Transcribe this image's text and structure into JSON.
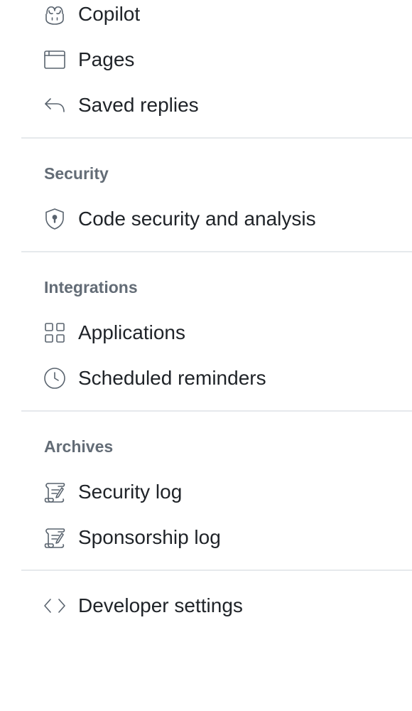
{
  "nav": {
    "items_top": [
      {
        "label": "Copilot",
        "icon": "copilot-icon"
      },
      {
        "label": "Pages",
        "icon": "browser-icon"
      },
      {
        "label": "Saved replies",
        "icon": "reply-icon"
      }
    ],
    "security": {
      "heading": "Security",
      "items": [
        {
          "label": "Code security and analysis",
          "icon": "shield-lock-icon"
        }
      ]
    },
    "integrations": {
      "heading": "Integrations",
      "items": [
        {
          "label": "Applications",
          "icon": "apps-icon"
        },
        {
          "label": "Scheduled reminders",
          "icon": "clock-icon"
        }
      ]
    },
    "archives": {
      "heading": "Archives",
      "items": [
        {
          "label": "Security log",
          "icon": "log-icon"
        },
        {
          "label": "Sponsorship log",
          "icon": "log-icon"
        }
      ]
    },
    "developer": {
      "label": "Developer settings",
      "icon": "code-icon"
    }
  }
}
